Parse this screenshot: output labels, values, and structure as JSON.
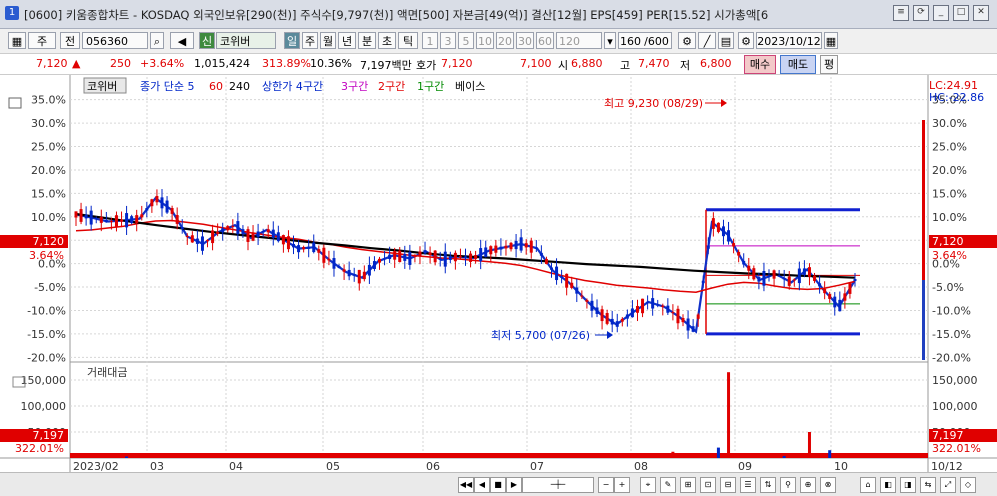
{
  "window": {
    "num": "1",
    "title": "[0600] 키움종합차트 - KOSDAQ 외국인보유[290(천)] 주식수[9,797(천)] 액면[500] 자본금[49(억)] 결산[12월] EPS[459] PER[15.52] 시가총액[6"
  },
  "toolbar": {
    "period": "주",
    "mode": "전",
    "code": "056360",
    "sign": "신",
    "stock_name": "코위버",
    "tf": [
      "일",
      "주",
      "월",
      "년",
      "분",
      "초",
      "틱"
    ],
    "mins": [
      "1",
      "3",
      "5",
      "10",
      "20",
      "30",
      "60",
      "120"
    ],
    "count": "160",
    "total": "/600",
    "date": "2023/10/12"
  },
  "price": {
    "last": "7,120",
    "arrow": "▲",
    "change": "250",
    "pct": "+3.64%",
    "volume": "1,015,424",
    "vol_ratio": "313.89%",
    "turnover": "10.36%",
    "amount": "7,197백만",
    "hoga_label": "호가",
    "hoga": "7,120",
    "bid": "7,100",
    "open_label": "시",
    "open": "6,880",
    "high_label": "고",
    "high": "7,470",
    "low_label": "저",
    "low": "6,800",
    "buy": "매수",
    "sell": "매도",
    "p": "평"
  },
  "legend": {
    "stock": "코위버",
    "ma": "종가 단순 5",
    "ma60": "60",
    "ma240": "240",
    "upper": "상한가 4구간",
    "z3": "3구간",
    "z2": "2구간",
    "z1": "1구간",
    "base": "베이스"
  },
  "corner": {
    "lc": "LC:24.91",
    "hc": "HC:-22.86"
  },
  "annotations": {
    "high": "최고 9,230 (08/29)",
    "low": "최저 5,700 (07/26)"
  },
  "volume_panel": {
    "title": "거래대금"
  },
  "colors": {
    "up": "#e00000",
    "down": "#0026c8",
    "ma5": "#1030c8",
    "ma60": "#e00000",
    "ma240": "#000000"
  },
  "chart_data": [
    {
      "type": "line",
      "title": "",
      "ylabel": "",
      "y_unit": "%",
      "y_ticks": [
        35,
        30,
        25,
        20,
        15,
        10,
        5,
        0,
        -5,
        -10,
        -15,
        -20
      ],
      "ylim": [
        -21,
        36
      ],
      "x_tick_labels": [
        "2023/02",
        "03",
        "04",
        "05",
        "06",
        "07",
        "08",
        "09",
        "10",
        "10/12"
      ],
      "current_label": "7,120",
      "current_pct": "3.64%",
      "series": [
        {
          "name": "종가 단순 5",
          "values": [
            10.5,
            9.8,
            9,
            9.2,
            9.6,
            14,
            11.5,
            5.8,
            4.2,
            6.8,
            8.2,
            5.5,
            7.2,
            5.2,
            3.2,
            3.5,
            0.6,
            -1.8,
            -3,
            0.5,
            1.8,
            1.1,
            2.6,
            0.8,
            1.5,
            1.2,
            2.8,
            3.5,
            4.2,
            3.3,
            -1.5,
            -4,
            -7.5,
            -10.8,
            -13,
            -10.5,
            -8.2,
            -9.2,
            -11.5,
            -14.5,
            8.8,
            6.2,
            0.2,
            -3.5,
            -2.2,
            -4,
            -1.2,
            -5.5,
            -9.2,
            -3.5
          ]
        },
        {
          "name": "60",
          "values": [
            7,
            7.2,
            7.6,
            8,
            8.6,
            9.1,
            9.2,
            8.8,
            8.4,
            7.8,
            7.2,
            6.6,
            6.1,
            5.6,
            5.2,
            4.6,
            4.1,
            3.5,
            3,
            2.6,
            2.2,
            1.8,
            1.5,
            1.2,
            1,
            0.7,
            0.4,
            0.1,
            -0.4,
            -1.2,
            -2.1,
            -2.9,
            -3.6,
            -4.1,
            -4.6,
            -4.9,
            -5.2,
            -5.6,
            -5.9,
            -6.1,
            -5.2,
            -4.4,
            -4,
            -4.2,
            -4.8,
            -5.3,
            -5.5,
            -5.3,
            -4.6,
            -3.8
          ]
        },
        {
          "name": "240",
          "values": [
            10.6,
            9.8,
            9,
            8.2,
            7.5,
            6.8,
            6.2,
            5.6,
            5,
            4.4,
            3.9,
            3.3,
            2.8,
            2.2,
            1.7,
            1.4,
            1.1,
            0.7,
            0.3,
            -0.1,
            -0.4,
            -0.7,
            -1.1,
            -1.5,
            -1.8,
            -2.1,
            -2.3,
            -2.6,
            -2.8,
            -3
          ]
        }
      ],
      "price_events": {
        "high": "9,230 (08/29)",
        "low": "5,700 (07/26)"
      }
    },
    {
      "type": "bar",
      "title": "거래대금",
      "y_ticks": [
        150000,
        100000,
        50000
      ],
      "ylim": [
        0,
        175000
      ],
      "current_label": "7,197",
      "current_pct": "322.01%",
      "x_index": [
        10,
        11,
        118,
        127,
        129,
        132,
        140,
        145,
        147,
        149
      ],
      "values": [
        3000,
        8000,
        12000,
        20000,
        165000,
        5000,
        4000,
        50000,
        9000,
        15000
      ]
    }
  ]
}
